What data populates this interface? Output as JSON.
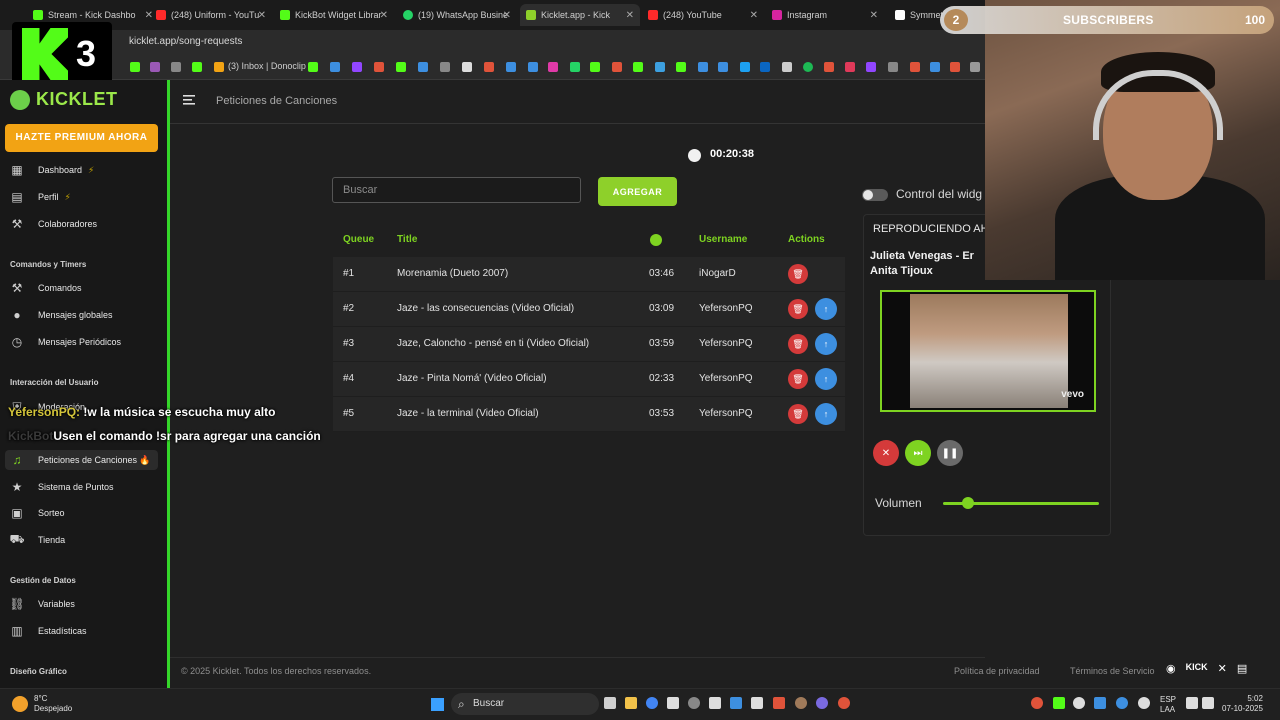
{
  "browser": {
    "tabs": [
      {
        "label": "Stream - Kick Dashbo",
        "color": "#53fc18"
      },
      {
        "label": "(248) Uniform - YouTu",
        "color": "#ff2a2a"
      },
      {
        "label": "KickBot Widget Librar",
        "color": "#53fc18"
      },
      {
        "label": "(19) WhatsApp Busine",
        "color": "#25d366"
      },
      {
        "label": "Kicklet.app - Kick",
        "color": "#8ed02a"
      },
      {
        "label": "(248) YouTube",
        "color": "#ff2a2a"
      },
      {
        "label": "Instagram",
        "color": "#d6249f"
      },
      {
        "label": "Symmet",
        "color": "#ffffff"
      }
    ],
    "url": "kicklet.app/song-requests",
    "bookmark_label": "(3) Inbox | Donoclip"
  },
  "stream_overlay": {
    "logo_number": "3",
    "subs_count": "2",
    "subs_label": "SUBSCRIBERS",
    "subs_goal": "100"
  },
  "sidebar": {
    "brand": "KICKLET",
    "premium": "HAZTE PREMIUM AHORA",
    "items_top": [
      {
        "label": "Dashboard",
        "icon": "grid-icon",
        "badge": "⚡"
      },
      {
        "label": "Perfil",
        "icon": "profile-icon",
        "badge": "⚡"
      },
      {
        "label": "Colaboradores",
        "icon": "tools-icon",
        "badge": ""
      }
    ],
    "section_commands": "Comandos y Timers",
    "items_commands": [
      {
        "label": "Comandos",
        "icon": "hammer-icon"
      },
      {
        "label": "Mensajes globales",
        "icon": "chat-icon"
      },
      {
        "label": "Mensajes Periódicos",
        "icon": "clock-icon"
      }
    ],
    "section_interaction": "Interacción del Usuario",
    "items_interaction": [
      {
        "label": "Moderación",
        "icon": "shield-icon"
      },
      {
        "label": "Peticiones de Canciones",
        "icon": "music-icon",
        "badge": "🔥"
      },
      {
        "label": "Sistema de Puntos",
        "icon": "star-icon"
      },
      {
        "label": "Sorteo",
        "icon": "gift-icon"
      },
      {
        "label": "Tienda",
        "icon": "cart-icon"
      }
    ],
    "section_data": "Gestión de Datos",
    "items_data": [
      {
        "label": "Variables",
        "icon": "link-icon"
      },
      {
        "label": "Estadísticas",
        "icon": "chart-icon"
      }
    ],
    "section_design": "Diseño Gráfico"
  },
  "main": {
    "page_title": "Peticiones de Canciones",
    "timer": "00:20:38",
    "search_placeholder": "Buscar",
    "add_button": "AGREGAR",
    "columns": {
      "queue": "Queue",
      "title": "Title",
      "username": "Username",
      "actions": "Actions"
    },
    "rows": [
      {
        "queue": "#1",
        "title": "Morenamia (Dueto 2007)",
        "duration": "03:46",
        "user": "iNogarD",
        "up": false
      },
      {
        "queue": "#2",
        "title": "Jaze - las consecuencias (Video Oficial)",
        "duration": "03:09",
        "user": "YefersonPQ",
        "up": true
      },
      {
        "queue": "#3",
        "title": "Jaze, Caloncho - pensé en ti (Video Oficial)",
        "duration": "03:59",
        "user": "YefersonPQ",
        "up": true
      },
      {
        "queue": "#4",
        "title": "Jaze - Pinta Nomá' (Video Oficial)",
        "duration": "02:33",
        "user": "YefersonPQ",
        "up": true
      },
      {
        "queue": "#5",
        "title": "Jaze - la terminal (Video Oficial)",
        "duration": "03:53",
        "user": "YefersonPQ",
        "up": true
      }
    ]
  },
  "player": {
    "toggle_label": "Control del widg",
    "now_playing": "REPRODUCIENDO AHO",
    "song_line1": "Julieta Venegas - Er",
    "song_line2": "Anita Tijoux",
    "video_brand": "vevo",
    "volume_label": "Volumen",
    "volume_level": 0.16
  },
  "footer": {
    "copyright": "© 2025 Kicklet. Todos los derechos reservados.",
    "privacy": "Política de privacidad",
    "terms": "Términos de Servicio",
    "kick_text": "KICK"
  },
  "chat": [
    {
      "user": "YefersonPQ:",
      "message": "!w la música se escucha muy alto"
    },
    {
      "user": "KickBot",
      "message": "Usen el comando !sr para agregar una canción"
    }
  ],
  "taskbar": {
    "temp": "8°C",
    "weather": "Despejado",
    "search": "Buscar",
    "lang1": "ESP",
    "lang2": "LAA",
    "time": "5:02",
    "date": "07-10-2025"
  }
}
